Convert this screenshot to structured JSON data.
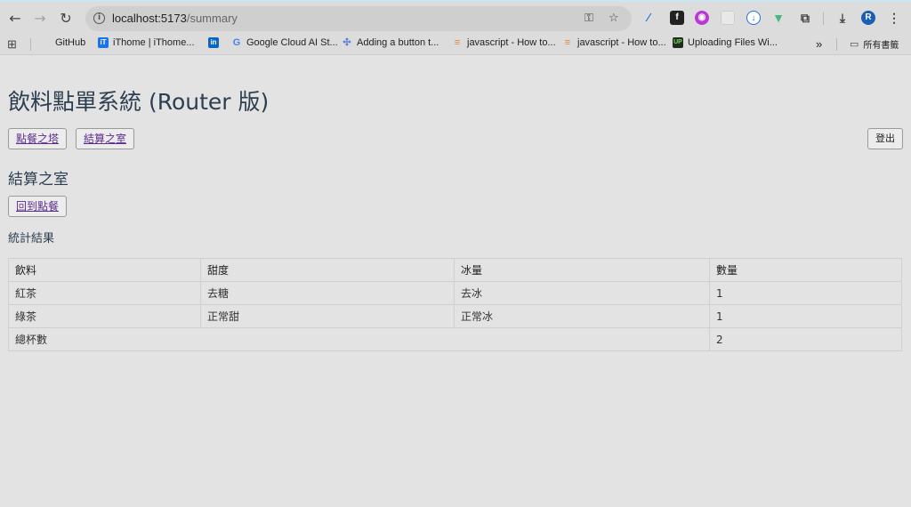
{
  "browser": {
    "url_host": "localhost:5173",
    "url_path": "/summary",
    "bookmarks": [
      {
        "label": "GitHub",
        "icon": "github-icon",
        "color": "#222222"
      },
      {
        "label": "iThome | iThome...",
        "icon": "ithome-icon",
        "color": "#1a73e8"
      },
      {
        "label": "",
        "icon": "linkedin-icon",
        "color": "#0a66c2"
      },
      {
        "label": "Google Cloud AI St...",
        "icon": "google-icon",
        "color": "#4285f4"
      },
      {
        "label": "Adding a button t...",
        "icon": "puzzle-icon",
        "color": "#5b7fd6"
      },
      {
        "label": "javascript - How to...",
        "icon": "stackoverflow-icon",
        "color": "#f48024"
      },
      {
        "label": "javascript - How to...",
        "icon": "stackoverflow-icon",
        "color": "#f48024"
      },
      {
        "label": "Uploading Files Wi...",
        "icon": "upload-icon",
        "color": "#1f2d1f"
      }
    ],
    "all_bookmarks": "所有書籤",
    "profile_initial": "R"
  },
  "app": {
    "title": "飲料點單系統 (Router 版)",
    "nav": {
      "order_link": "點餐之塔",
      "summary_link": "結算之室",
      "logout": "登出"
    },
    "section_title": "結算之室",
    "back_button": "回到點餐",
    "stats_title": "統計結果",
    "table": {
      "headers": [
        "飲料",
        "甜度",
        "冰量",
        "數量"
      ],
      "rows": [
        [
          "紅茶",
          "去糖",
          "去冰",
          "1"
        ],
        [
          "綠茶",
          "正常甜",
          "正常冰",
          "1"
        ]
      ],
      "total_label": "總杯數",
      "total_value": "2"
    }
  }
}
